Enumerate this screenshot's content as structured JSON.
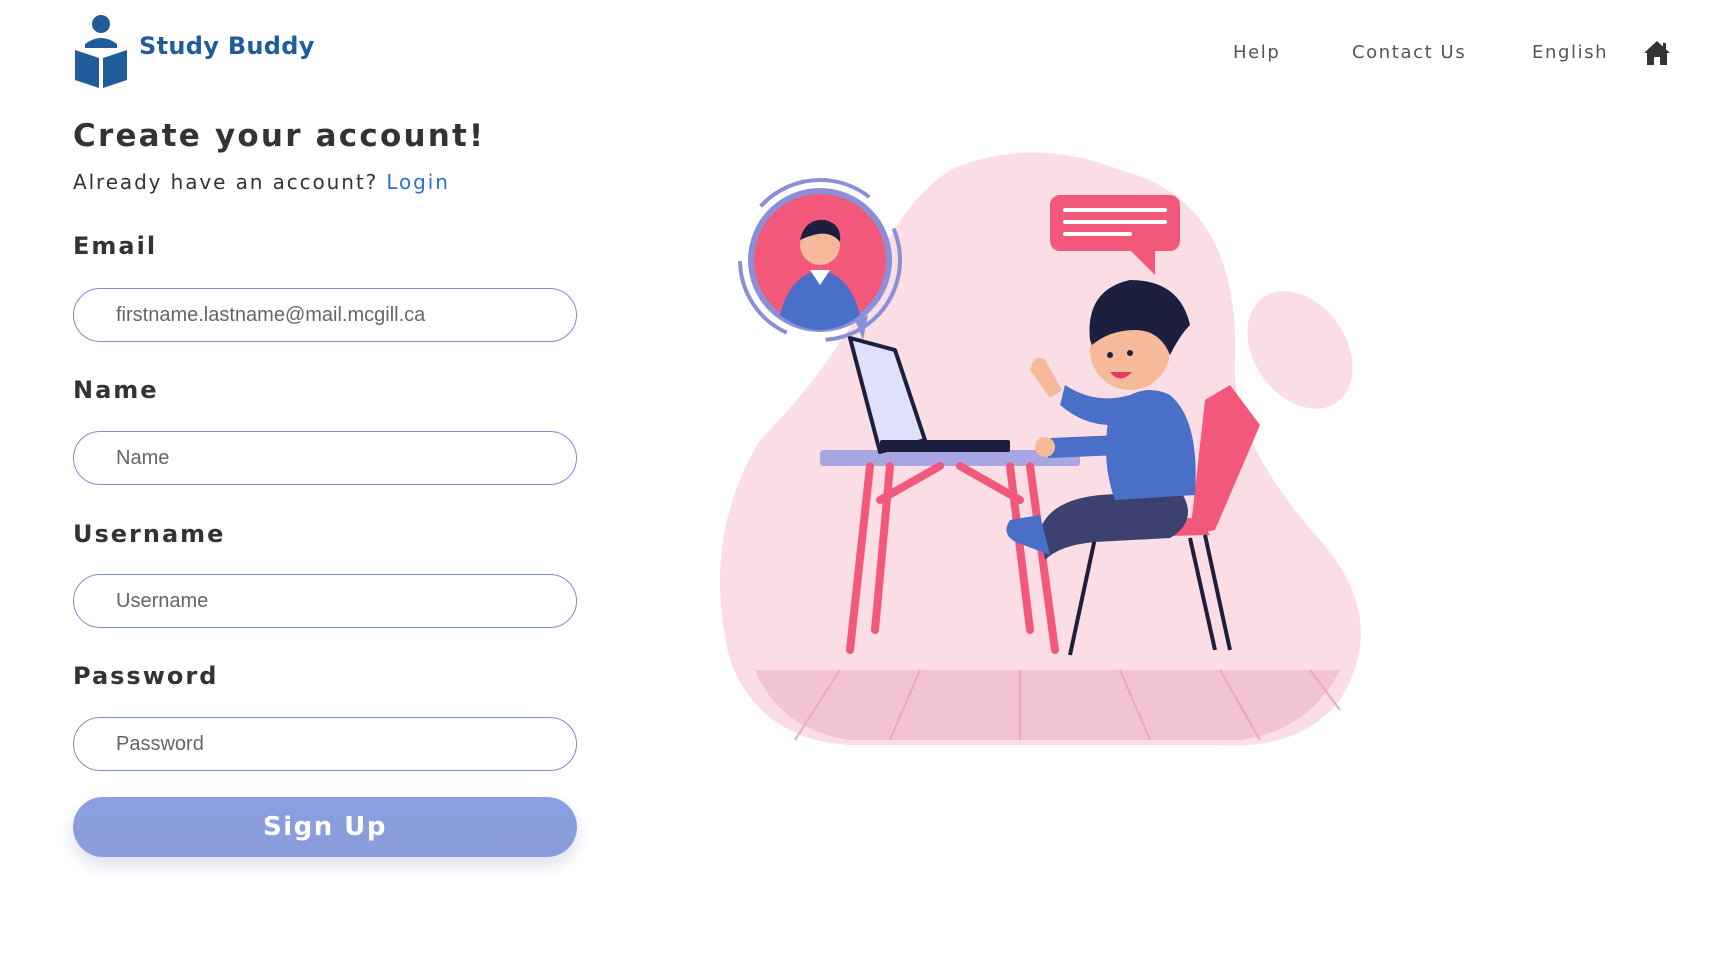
{
  "header": {
    "brand": "Study Buddy",
    "logo_icon": "book-reader-icon",
    "nav": {
      "help": "Help",
      "contact": "Contact Us",
      "language": "English"
    },
    "home_icon": "home-icon"
  },
  "form": {
    "title": "Create your account!",
    "subtitle_prefix": "Already have an account?",
    "login_link": "Login",
    "email": {
      "label": "Email",
      "placeholder": "firstname.lastname@mail.mcgill.ca"
    },
    "name": {
      "label": "Name",
      "placeholder": "Name"
    },
    "username": {
      "label": "Username",
      "placeholder": "Username"
    },
    "password": {
      "label": "Password",
      "placeholder": "Password"
    },
    "submit_label": "Sign Up"
  },
  "colors": {
    "brand": "#1f5c99",
    "link": "#2f6ed6",
    "button": "#8a9ddd",
    "input_border": "#7a8fd0",
    "illustration_blob": "#fbdde6",
    "illustration_accent": "#f2587a",
    "illustration_blue": "#4a6fc9"
  }
}
